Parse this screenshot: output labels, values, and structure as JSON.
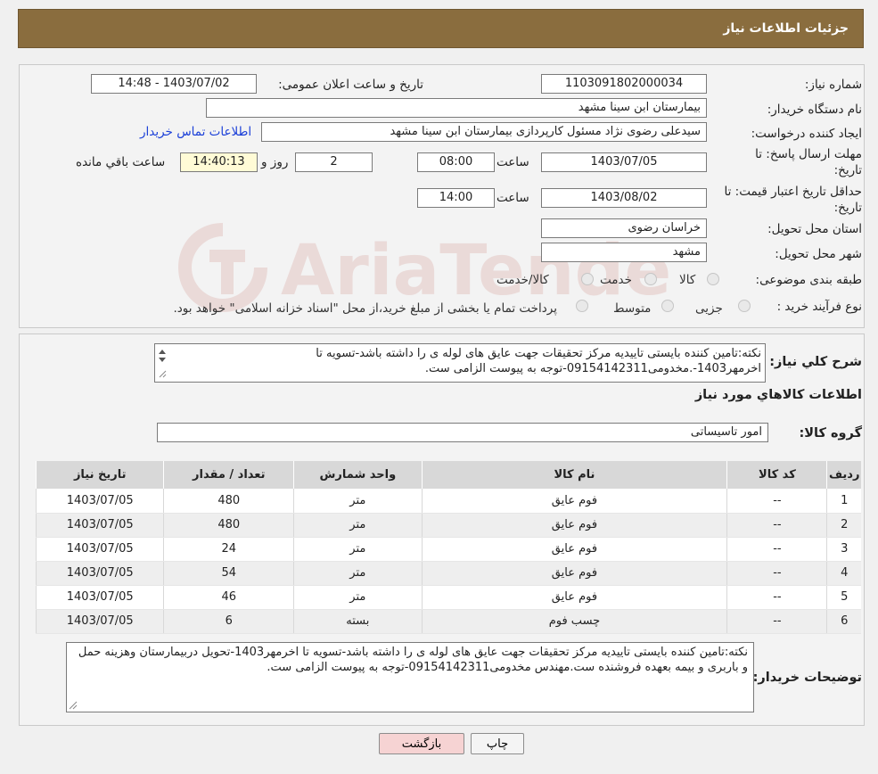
{
  "header": {
    "title": "جزئیات اطلاعات نیاز"
  },
  "fields": {
    "need_number_label": "شماره نیاز:",
    "need_number": "1103091802000034",
    "announce_label": "تاریخ و ساعت اعلان عمومی:",
    "announce_value": "1403/07/02 - 14:48",
    "buyer_label": "نام دستگاه خریدار:",
    "buyer_value": "بیمارستان ابن سینا مشهد",
    "creator_label": "ایجاد کننده درخواست:",
    "creator_value": "سیدعلی رضوی نژاد مسئول کارپردازی بیمارستان ابن سینا مشهد",
    "contact_link": "اطلاعات تماس خریدار",
    "deadline_label_1": "مهلت ارسال پاسخ: تا",
    "deadline_label_2": "تاریخ:",
    "deadline_date": "1403/07/05",
    "time_label": "ساعت",
    "deadline_time": "08:00",
    "days_value": "2",
    "days_label": "روز و",
    "remaining_time": "14:40:13",
    "remaining_label": "ساعت باقي مانده",
    "validity_label_1": "حداقل تاریخ اعتبار قیمت: تا",
    "validity_label_2": "تاریخ:",
    "validity_date": "1403/08/02",
    "validity_time": "14:00",
    "province_label": "استان محل تحویل:",
    "province_value": "خراسان رضوی",
    "city_label": "شهر محل تحویل:",
    "city_value": "مشهد",
    "category_label": "طبقه بندی موضوعی:",
    "category_options": [
      "کالا",
      "خدمت",
      "کالا/خدمت"
    ],
    "process_label": "نوع فرآیند خرید :",
    "process_options": [
      "جزیی",
      "متوسط"
    ],
    "process_note": "پرداخت تمام یا بخشی از مبلغ خرید،از محل \"اسناد خزانه اسلامی\" خواهد بود."
  },
  "description": {
    "label": "شرح کلي نياز:",
    "text": "نکته:تامین کننده بایستی تاییدیه مرکز تحقیقات جهت عایق های لوله ی را داشته باشد-تسویه تا اخرمهر1403-.مخدومی09154142311-توجه به پیوست الزامی ست."
  },
  "goods": {
    "title": "اطلاعات کالاهاي مورد نياز",
    "group_label": "گروه کالا:",
    "group_value": "امور تاسیساتی",
    "columns": [
      "رديف",
      "کد کالا",
      "نام کالا",
      "واحد شمارش",
      "تعداد / مقدار",
      "تاریخ نیاز"
    ],
    "rows": [
      {
        "idx": "1",
        "code": "--",
        "name": "فوم عایق",
        "unit": "متر",
        "qty": "480",
        "date": "1403/07/05"
      },
      {
        "idx": "2",
        "code": "--",
        "name": "فوم عایق",
        "unit": "متر",
        "qty": "480",
        "date": "1403/07/05"
      },
      {
        "idx": "3",
        "code": "--",
        "name": "فوم عایق",
        "unit": "متر",
        "qty": "24",
        "date": "1403/07/05"
      },
      {
        "idx": "4",
        "code": "--",
        "name": "فوم عایق",
        "unit": "متر",
        "qty": "54",
        "date": "1403/07/05"
      },
      {
        "idx": "5",
        "code": "--",
        "name": "فوم عایق",
        "unit": "متر",
        "qty": "46",
        "date": "1403/07/05"
      },
      {
        "idx": "6",
        "code": "--",
        "name": "چسب فوم",
        "unit": "بسته",
        "qty": "6",
        "date": "1403/07/05"
      }
    ]
  },
  "buyer_notes": {
    "label": "توضیحات خریدار:",
    "text": "نکته:تامین کننده بایستی تاییدیه مرکز تحقیقات جهت عایق های لوله ی را داشته باشد-تسویه تا اخرمهر1403-تحویل دربیمارستان وهزینه حمل و باربری و بیمه بعهده فروشنده ست.مهندس مخدومی09154142311-توجه به پیوست الزامی ست."
  },
  "buttons": {
    "print": "چاپ",
    "back": "بازگشت"
  },
  "watermark": {
    "text": "AriaTender.neT"
  },
  "colors": {
    "header": "#8a6d3e",
    "link": "#1a3fd8",
    "back_button": "#f6d3d3",
    "watermark": "#b33a2e"
  }
}
